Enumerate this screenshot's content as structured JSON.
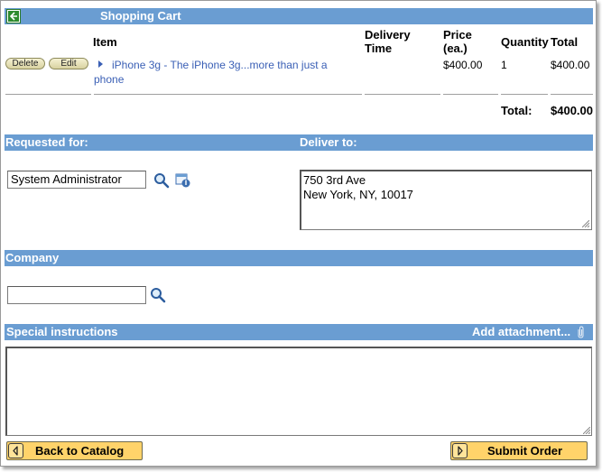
{
  "cart": {
    "title": "Shopping Cart",
    "columns": {
      "item": "Item",
      "delivery_time_1": "Delivery",
      "delivery_time_2": "Time",
      "price_1": "Price",
      "price_2": "(ea.)",
      "quantity": "Quantity",
      "total": "Total"
    },
    "row": {
      "delete_label": "Delete",
      "edit_label": "Edit",
      "item_line1": "iPhone 3g - The iPhone 3g...more than just a",
      "item_line2": "phone",
      "price": "$400.00",
      "quantity": "1",
      "total": "$400.00"
    },
    "total_label": "Total:",
    "total_value": "$400.00"
  },
  "requested_for": {
    "label": "Requested for:",
    "value": "System Administrator"
  },
  "deliver_to": {
    "label": "Deliver to:",
    "line1": "750 3rd Ave",
    "line2": "New York, NY, 10017"
  },
  "company": {
    "label": "Company",
    "value": ""
  },
  "special_instructions": {
    "label": "Special instructions",
    "add_attachment": "Add attachment...",
    "value": ""
  },
  "buttons": {
    "back": "Back to Catalog",
    "submit": "Submit Order"
  },
  "colors": {
    "section_bar": "#6a9dd2",
    "button": "#ffd36a",
    "link": "#3a5fb5"
  },
  "icons": {
    "back": "back-arrow-icon",
    "lookup": "magnifier-icon",
    "user_info": "user-info-icon",
    "attachment": "paperclip-icon"
  }
}
